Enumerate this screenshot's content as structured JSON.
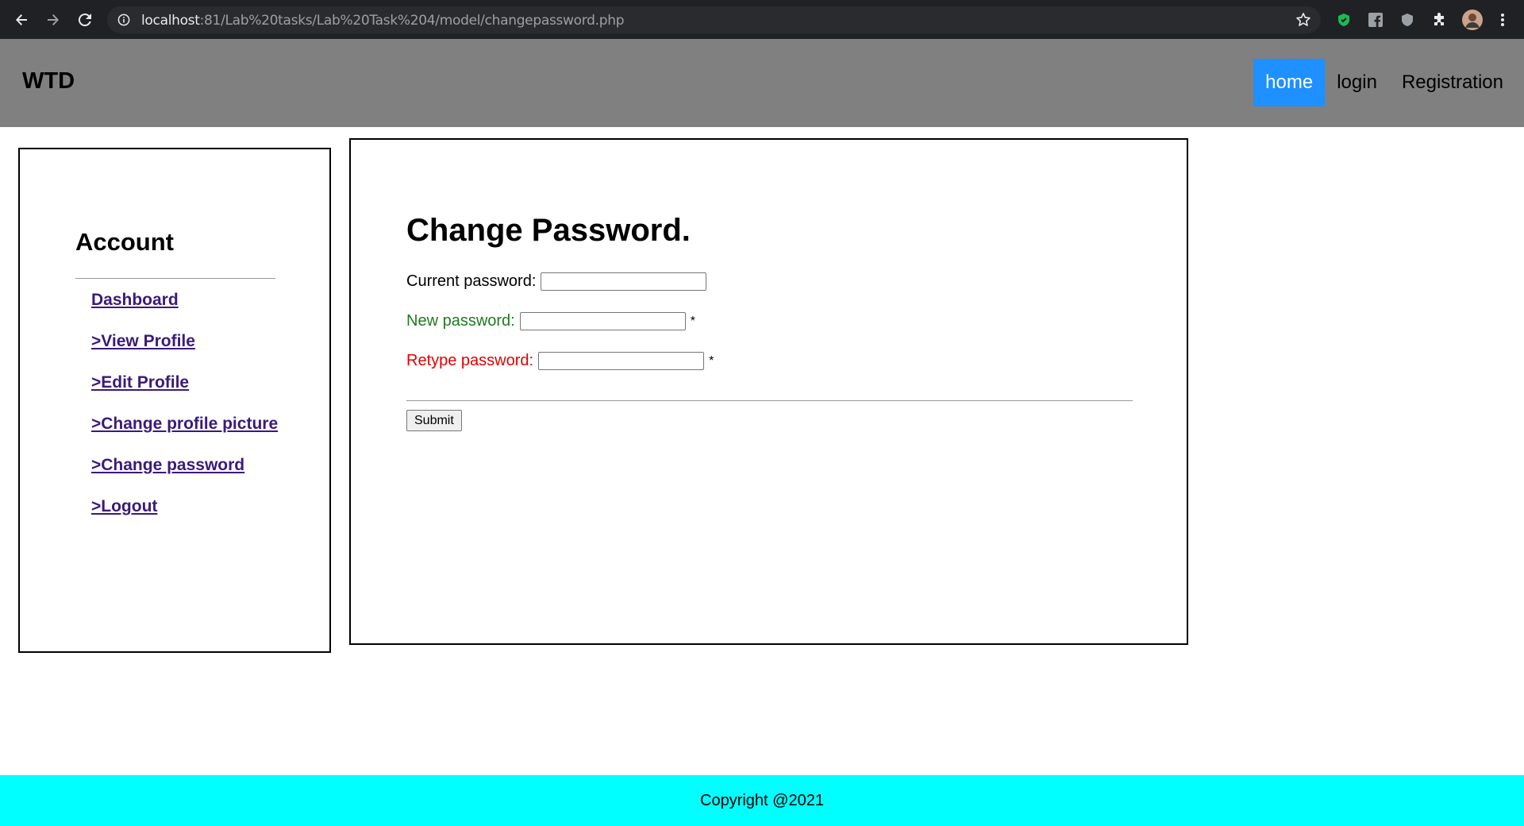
{
  "browser": {
    "url_host": "localhost",
    "url_rest": ":81/Lab%20tasks/Lab%20Task%204/model/changepassword.php",
    "icons": [
      "back-arrow-icon",
      "forward-arrow-icon",
      "reload-icon",
      "info-icon",
      "star-icon",
      "adblock-icon",
      "facebook-ext-icon",
      "shield-icon",
      "puzzle-icon",
      "avatar",
      "kebab-menu-icon"
    ]
  },
  "header": {
    "brand": "WTD",
    "nav": [
      {
        "label": "home",
        "active": true
      },
      {
        "label": "login"
      },
      {
        "label": "Registration"
      }
    ],
    "active_color": "#1e90ff",
    "background": "#808080"
  },
  "sidebar": {
    "title": "Account",
    "links": [
      {
        "label": "Dashboard"
      },
      {
        "label": ">View Profile"
      },
      {
        "label": ">Edit Profile"
      },
      {
        "label": ">Change profile picture"
      },
      {
        "label": ">Change password"
      },
      {
        "label": ">Logout"
      }
    ]
  },
  "form": {
    "title": "Change Password.",
    "fields": [
      {
        "label": "Current password:",
        "value": "",
        "required_mark": "",
        "color": "#000000"
      },
      {
        "label": "New password:",
        "value": "",
        "required_mark": "*",
        "color": "#1f7a1f"
      },
      {
        "label": "Retype password:",
        "value": "",
        "required_mark": "*",
        "color": "#e00000"
      }
    ],
    "submit_label": "Submit"
  },
  "footer": {
    "text": "Copyright @2021",
    "background": "#00ffff"
  }
}
